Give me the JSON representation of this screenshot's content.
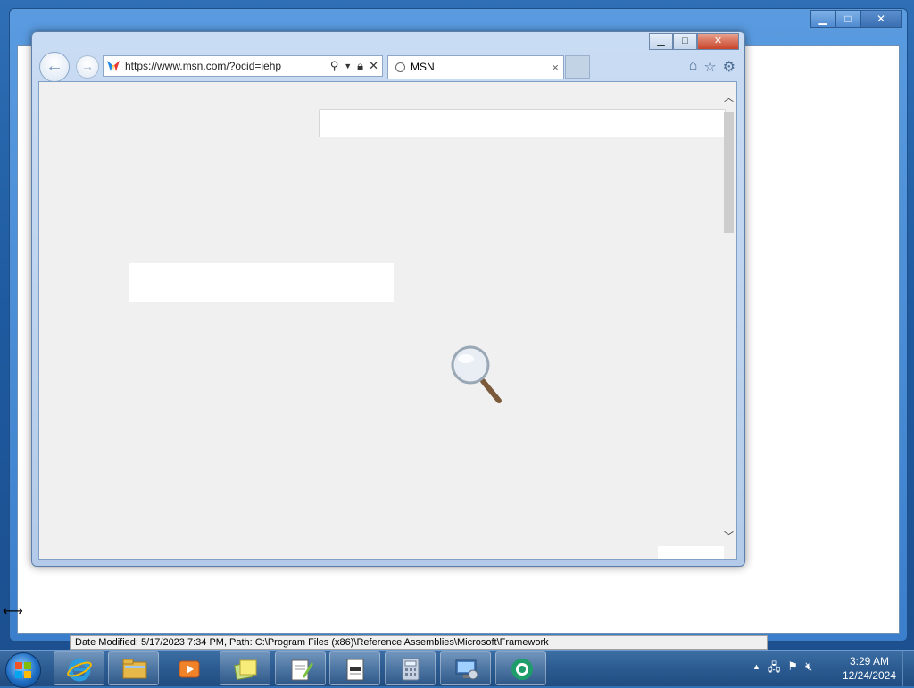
{
  "background_window": {
    "controls": {
      "minimize": "▁",
      "maximize": "□",
      "close": "✕"
    },
    "status_text": "Date Modified: 5/17/2023 7:34 PM, Path: C:\\Program Files (x86)\\Reference Assemblies\\Microsoft\\Framework"
  },
  "ie": {
    "controls": {
      "minimize": "▁",
      "maximize": "□",
      "close": "✕"
    },
    "address_url": "https://www.msn.com/?ocid=iehp",
    "tab_title": "MSN",
    "tab_close": "×",
    "scroll_up": "︿",
    "scroll_down": "﹀"
  },
  "taskbar": {
    "apps": [
      "internet-explorer",
      "file-explorer",
      "media-player",
      "sticky-notes",
      "notepad-plus-plus",
      "text-document",
      "calculator",
      "remote-desktop",
      "app-green-circle"
    ],
    "tray_arrow": "▲",
    "time": "3:29 AM",
    "date": "12/24/2024"
  },
  "colors": {
    "taskbar": "#2b5b91",
    "ie_frame": "#c9dcf3",
    "content_bg": "#f0f0f0",
    "close_red": "#c8442a"
  }
}
